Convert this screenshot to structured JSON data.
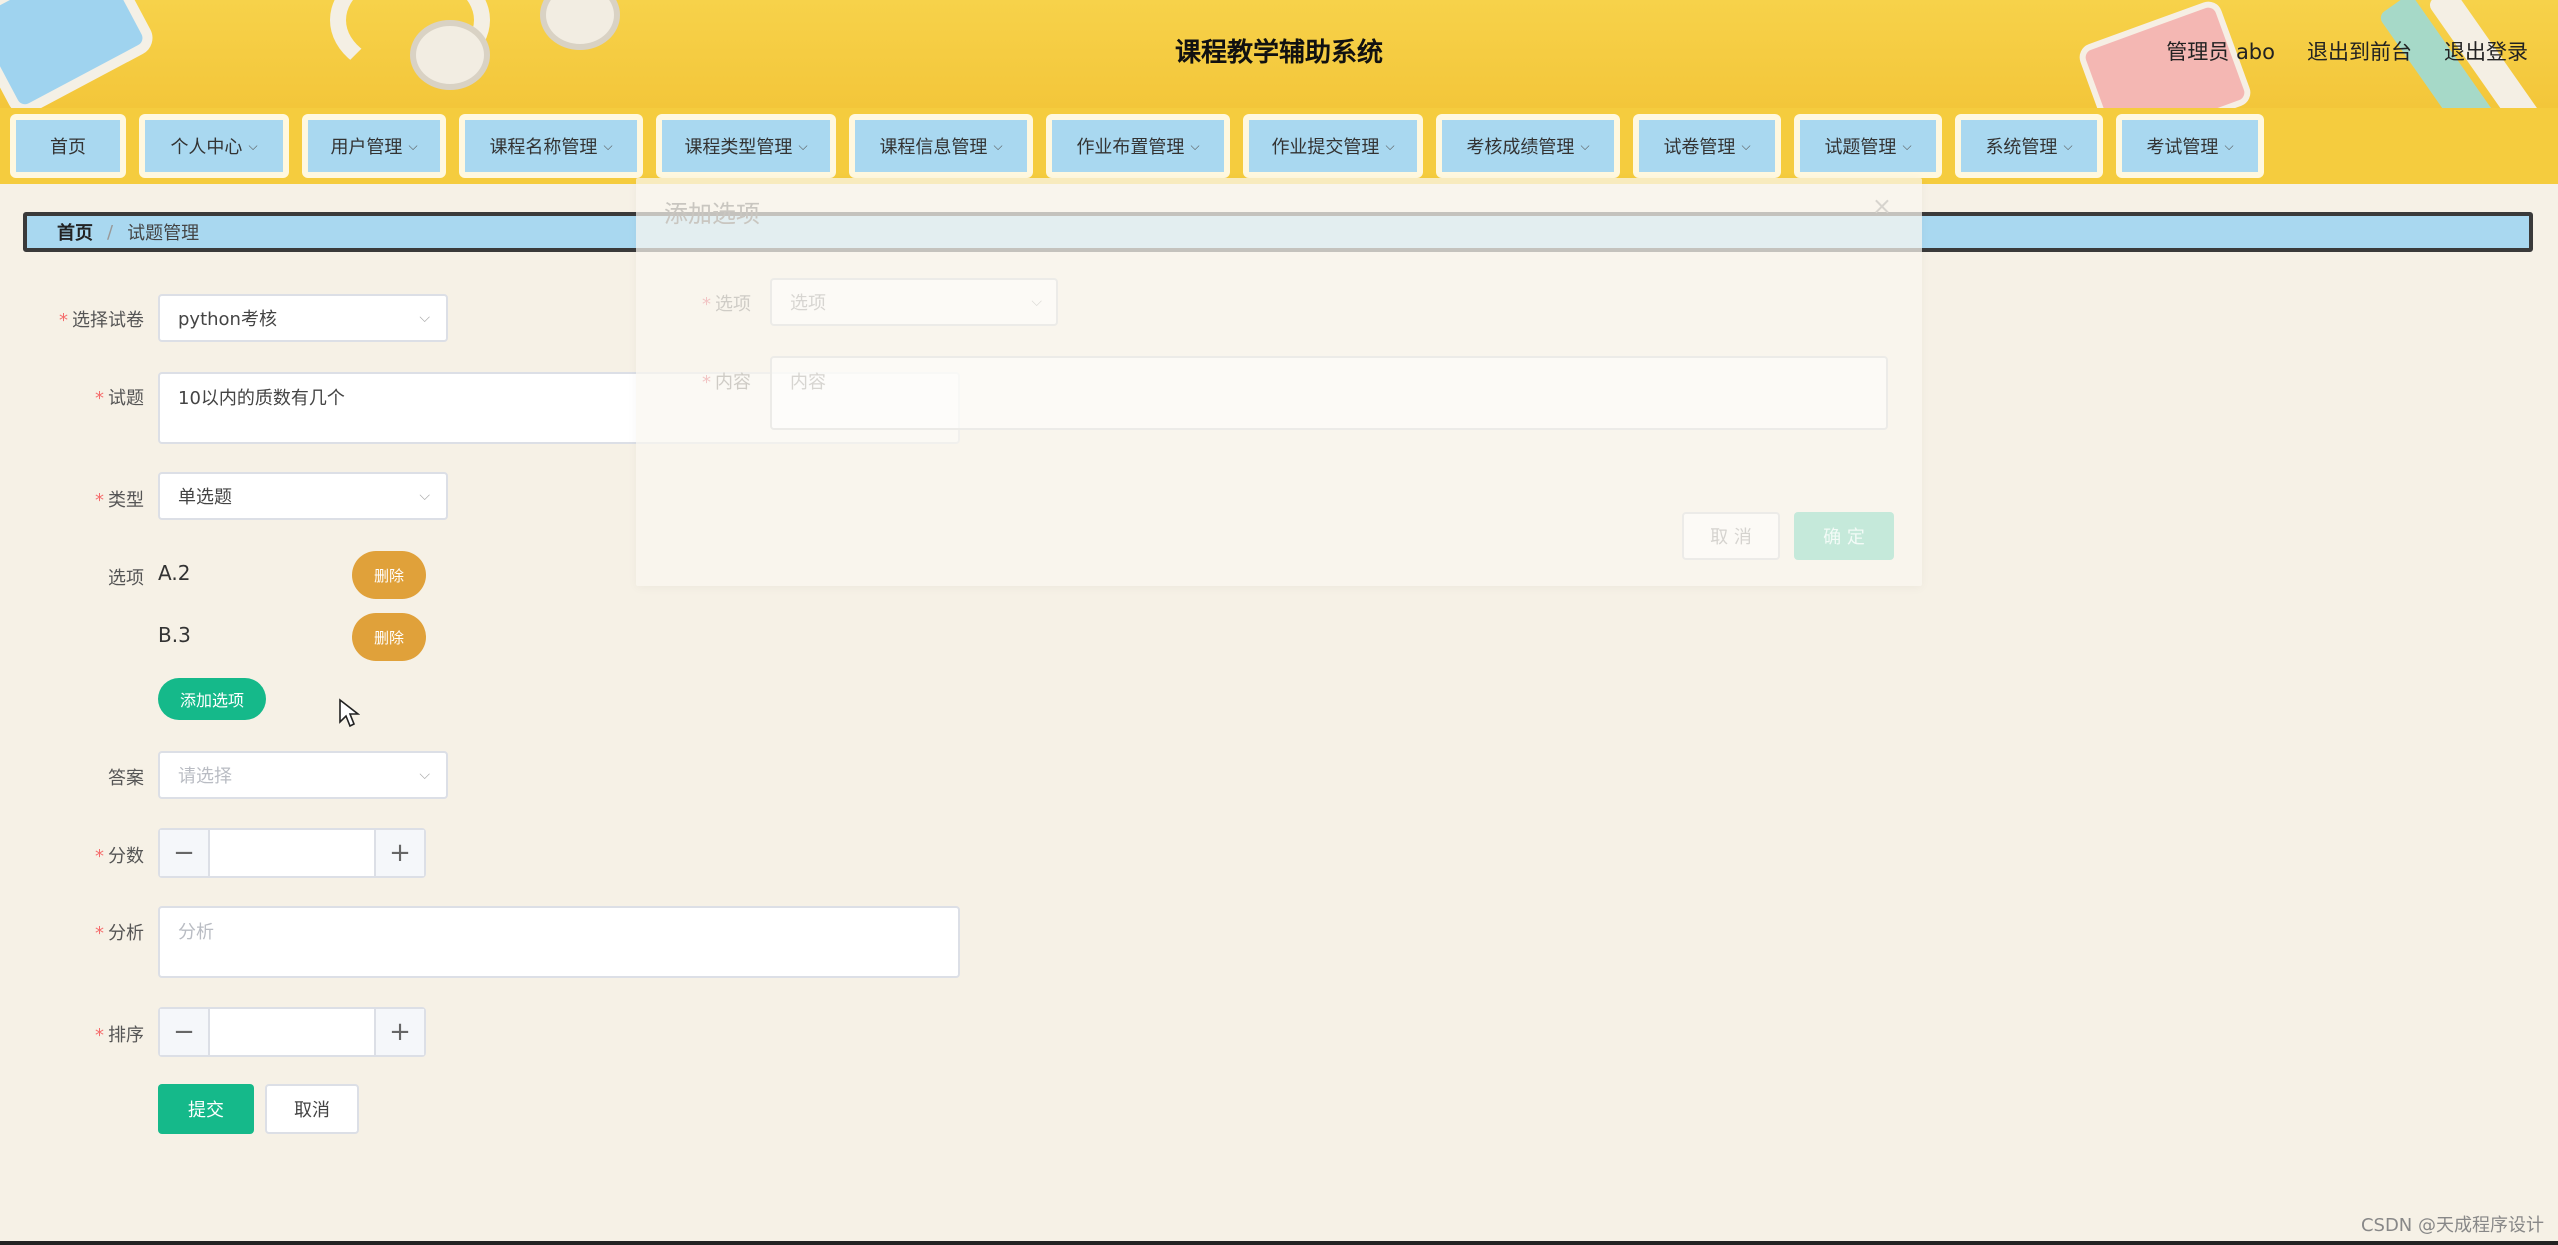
{
  "app": {
    "title": "课程教学辅助系统"
  },
  "top_links": {
    "admin": "管理员 abo",
    "front": "退出到前台",
    "logout": "退出登录"
  },
  "nav": [
    {
      "label": "首页",
      "dropdown": false
    },
    {
      "label": "个人中心",
      "dropdown": true
    },
    {
      "label": "用户管理",
      "dropdown": true
    },
    {
      "label": "课程名称管理",
      "dropdown": true
    },
    {
      "label": "课程类型管理",
      "dropdown": true
    },
    {
      "label": "课程信息管理",
      "dropdown": true
    },
    {
      "label": "作业布置管理",
      "dropdown": true
    },
    {
      "label": "作业提交管理",
      "dropdown": true
    },
    {
      "label": "考核成绩管理",
      "dropdown": true
    },
    {
      "label": "试卷管理",
      "dropdown": true
    },
    {
      "label": "试题管理",
      "dropdown": true
    },
    {
      "label": "系统管理",
      "dropdown": true
    },
    {
      "label": "考试管理",
      "dropdown": true
    }
  ],
  "breadcrumb": {
    "home": "首页",
    "separator": "/",
    "current": "试题管理"
  },
  "form": {
    "paper": {
      "label": "选择试卷",
      "value": "python考核"
    },
    "question": {
      "label": "试题",
      "value": "10以内的质数有几个"
    },
    "type": {
      "label": "类型",
      "value": "单选题"
    },
    "options": {
      "label": "选项",
      "items": [
        {
          "text": "A.2",
          "delete_label": "删除"
        },
        {
          "text": "B.3",
          "delete_label": "删除"
        }
      ],
      "add_label": "添加选项"
    },
    "answer": {
      "label": "答案",
      "placeholder": "请选择"
    },
    "score": {
      "label": "分数",
      "minus": "−",
      "plus": "+"
    },
    "analysis": {
      "label": "分析",
      "placeholder": "分析"
    },
    "order": {
      "label": "排序",
      "minus": "−",
      "plus": "+"
    },
    "submit_label": "提交",
    "cancel_label": "取消",
    "required_mark": "*"
  },
  "dialog": {
    "title": "添加选项",
    "close": "×",
    "option_label": "选项",
    "option_placeholder": "选项",
    "content_label": "内容",
    "content_placeholder": "内容",
    "cancel_label": "取 消",
    "ok_label": "确 定"
  },
  "watermark": "CSDN @天成程序设计",
  "colors": {
    "header_yellow": "#f5cc3e",
    "nav_tab_blue": "#a9d8f0",
    "primary_green": "#15b98a",
    "delete_orange": "#e0a13a",
    "required_red": "#f56c6c",
    "page_bg": "#f6f1e6"
  },
  "icons": {
    "dropdown": "chevron-down-icon",
    "cursor": "mouse-pointer-icon"
  }
}
